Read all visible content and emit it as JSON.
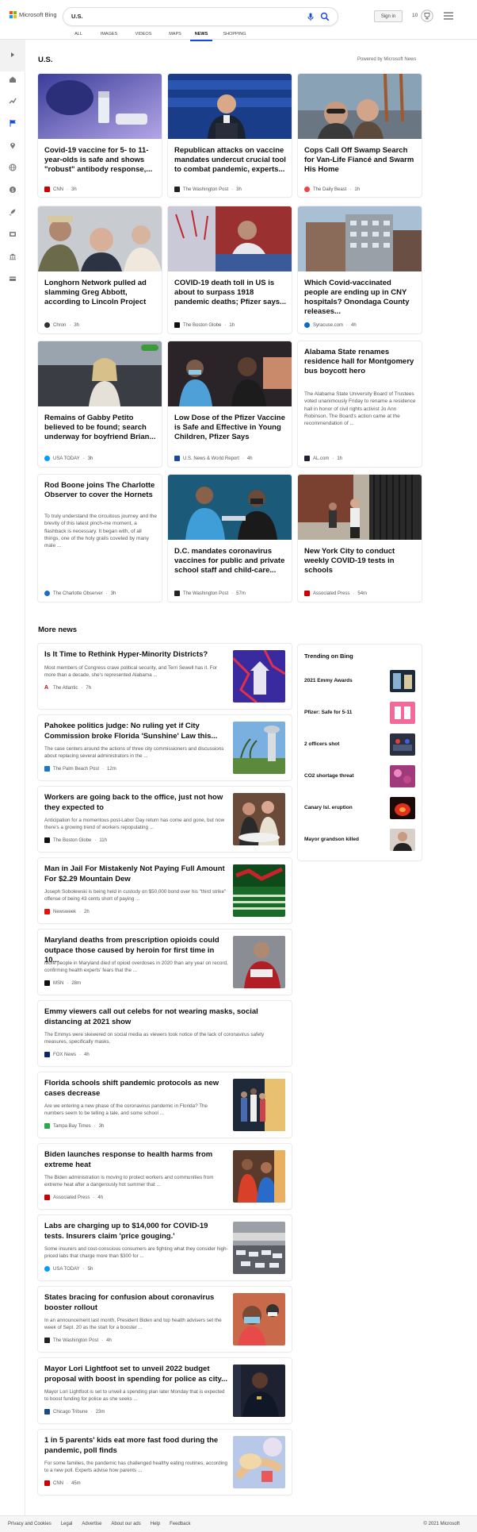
{
  "header": {
    "logo_text": "Microsoft Bing",
    "search_query": "U.S.",
    "signin_label": "Sign in",
    "points": "10"
  },
  "nav": [
    "ALL",
    "IMAGES",
    "VIDEOS",
    "MAPS",
    "NEWS",
    "SHOPPING"
  ],
  "section": {
    "title": "U.S.",
    "powered_by": "Powered by Microsoft News"
  },
  "cards": [
    {
      "title": "Covid-19 vaccine for 5- to 11-year-olds is safe and shows \"robust\" antibody response,...",
      "source": "CNN",
      "time": "3h"
    },
    {
      "title": "Republican attacks on vaccine mandates undercut crucial tool to combat pandemic, experts...",
      "source": "The Washington Post",
      "time": "3h"
    },
    {
      "title": "Cops Call Off Swamp Search for Van-Life Fiancé and Swarm His Home",
      "source": "The Daily Beast",
      "time": "1h"
    },
    {
      "title": "Longhorn Network pulled ad slamming Greg Abbott, according to Lincoln Project",
      "source": "Chron",
      "time": "3h"
    },
    {
      "title": "COVID-19 death toll in US is about to surpass 1918 pandemic deaths; Pfizer says...",
      "source": "The Boston Globe",
      "time": "1h"
    },
    {
      "title": "Which Covid-vaccinated people are ending up in CNY hospitals? Onondaga County releases...",
      "source": "Syracuse.com",
      "time": "4h"
    },
    {
      "title": "Remains of Gabby Petito believed to be found; search underway for boyfriend Brian...",
      "source": "USA TODAY",
      "time": "3h"
    },
    {
      "title": "Low Dose of the Pfizer Vaccine is Safe and Effective in Young Children, Pfizer Says",
      "source": "U.S. News & World Report",
      "time": "4h"
    },
    {
      "title": "Alabama State renames residence hall for Montgomery bus boycott hero",
      "snippet": "The Alabama State University Board of Trustees voted unanimously Friday to rename a residence hall in honor of civil rights activist Jo Ann Robinson. The Board's action came at the recommendation of ...",
      "source": "AL.com",
      "time": "1h"
    },
    {
      "title": "Rod Boone joins The Charlotte Observer to cover the Hornets",
      "snippet": "To truly understand the circuitous journey and the brevity of this latest pinch-me moment, a flashback is necessary. It began with, of all things, one of the holy grails coveted by many male ...",
      "source": "The Charlotte Observer",
      "time": "3h"
    },
    {
      "title": "D.C. mandates coronavirus vaccines for public and private school staff and child-care...",
      "source": "The Washington Post",
      "time": "57m"
    },
    {
      "title": "New York City to conduct weekly COVID-19 tests in schools",
      "source": "Associated Press",
      "time": "54m"
    }
  ],
  "more_news": {
    "title": "More news",
    "items": [
      {
        "title": "Is It Time to Rethink Hyper-Minority Districts?",
        "snippet": "Most members of Congress crave political security, and Terri Sewell has it. For more than a decade, she's represented Alabama ...",
        "source": "The Atlantic",
        "time": "7h"
      },
      {
        "title": "Pahokee politics judge: No ruling yet if City Commission broke Florida 'Sunshine' Law this...",
        "snippet": "The case centers around the actions of three city commissioners and discussions about replacing several administrators in the ...",
        "source": "The Palm Beach Post",
        "time": "12m"
      },
      {
        "title": "Workers are going back to the office, just not how they expected to",
        "snippet": "Anticipation for a momentous post-Labor Day return has come and gone, but now there's a growing trend of workers repopulating ...",
        "source": "The Boston Globe",
        "time": "11h"
      },
      {
        "title": "Man in Jail For Mistakenly Not Paying Full Amount For $2.29 Mountain Dew",
        "snippet": "Joseph Sobolewski is being held in custody on $50,000 bond over his \"third strike\" offense of being 43 cents short of paying ...",
        "source": "Newsweek",
        "time": "2h"
      },
      {
        "title": "Maryland deaths from prescription opioids could outpace those caused by heroin for first time in 10...",
        "snippet": "More people in Maryland died of opioid overdoses in 2020 than any year on record, confirming health experts' fears that the ...",
        "source": "MSN",
        "time": "28m"
      },
      {
        "title": "Emmy viewers call out celebs for not wearing masks, social distancing at 2021 show",
        "snippet": "The Emmys were skewered on social media as viewers took notice of the lack of coronavirus safety measures, specifically masks.",
        "source": "FOX News",
        "time": "4h"
      },
      {
        "title": "Florida schools shift pandemic protocols as new cases decrease",
        "snippet": "Are we entering a new phase of the coronavirus pandemic in Florida? The numbers seem to be telling a tale, and some school ...",
        "source": "Tampa Bay Times",
        "time": "3h"
      },
      {
        "title": "Biden launches response to health harms from extreme heat",
        "snippet": "The Biden administration is moving to protect workers and communities from extreme heat after a dangerously hot summer that ...",
        "source": "Associated Press",
        "time": "4h"
      },
      {
        "title": "Labs are charging up to $14,000 for COVID-19 tests. Insurers claim 'price gouging.'",
        "snippet": "Some insurers and cost-conscious consumers are fighting what they consider high-priced labs that charge more than $300 for ...",
        "source": "USA TODAY",
        "time": "5h"
      },
      {
        "title": "States bracing for confusion about coronavirus booster rollout",
        "snippet": "In an announcement last month, President Biden and top health advisers set the week of Sept. 20 as the start for a booster ...",
        "source": "The Washington Post",
        "time": "4h"
      },
      {
        "title": "Mayor Lori Lightfoot set to unveil 2022 budget proposal with boost in spending for police as city...",
        "snippet": "Mayor Lori Lightfoot is set to unveil a spending plan later Monday that is expected to boost funding for police as she seeks ...",
        "source": "Chicago Tribune",
        "time": "23m"
      },
      {
        "title": "1 in 5 parents' kids eat more fast food during the pandemic, poll finds",
        "snippet": "For some families, the pandemic has challenged healthy eating routines, according to a new poll. Experts advise how parents ...",
        "source": "CNN",
        "time": "45m"
      }
    ]
  },
  "trending": {
    "title": "Trending on Bing",
    "items": [
      "2021 Emmy Awards",
      "Pfizer: Safe for 5-11",
      "2 officers shot",
      "CO2 shortage threat",
      "Canary Isl. eruption",
      "Mayor grandson killed"
    ]
  },
  "footer": {
    "links": [
      "Privacy and Cookies",
      "Legal",
      "Advertise",
      "About our ads",
      "Help",
      "Feedback"
    ],
    "copyright": "© 2021 Microsoft"
  }
}
